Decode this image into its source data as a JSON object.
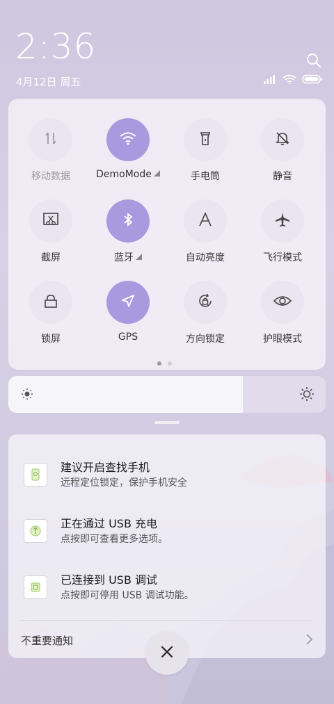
{
  "status": {
    "time": "2:36",
    "date": "4月12日 周五"
  },
  "quick_settings": {
    "tiles": [
      {
        "label": "移动数据",
        "icon": "mobile-data-icon",
        "active": false,
        "dim": true
      },
      {
        "label": "DemoMode",
        "icon": "wifi-icon",
        "active": true,
        "dropdown": true
      },
      {
        "label": "手电筒",
        "icon": "flashlight-icon",
        "active": false
      },
      {
        "label": "静音",
        "icon": "mute-icon",
        "active": false
      },
      {
        "label": "截屏",
        "icon": "screenshot-icon",
        "active": false
      },
      {
        "label": "蓝牙",
        "icon": "bluetooth-icon",
        "active": true,
        "dropdown": true
      },
      {
        "label": "自动亮度",
        "icon": "auto-brightness-icon",
        "active": false
      },
      {
        "label": "飞行模式",
        "icon": "airplane-icon",
        "active": false
      },
      {
        "label": "锁屏",
        "icon": "lock-icon",
        "active": false
      },
      {
        "label": "GPS",
        "icon": "gps-icon",
        "active": true
      },
      {
        "label": "方向锁定",
        "icon": "rotation-lock-icon",
        "active": false
      },
      {
        "label": "护眼模式",
        "icon": "eye-icon",
        "active": false
      }
    ],
    "page_count": 2,
    "current_page": 1
  },
  "brightness": {
    "level": 0.74
  },
  "notifications": {
    "items": [
      {
        "title": "建议开启查找手机",
        "subtitle": "远程定位锁定，保护手机安全",
        "icon": "find-phone-icon"
      },
      {
        "title": "正在通过 USB 充电",
        "subtitle": "点按即可查看更多选项。",
        "icon": "usb-charging-icon"
      },
      {
        "title": "已连接到 USB 调试",
        "subtitle": "点按即可停用 USB 调试功能。",
        "icon": "usb-debug-icon"
      }
    ],
    "footer_label": "不重要通知"
  },
  "colors": {
    "active_tile": "#a99ae0",
    "inactive_tile": "#e9e5f0"
  }
}
